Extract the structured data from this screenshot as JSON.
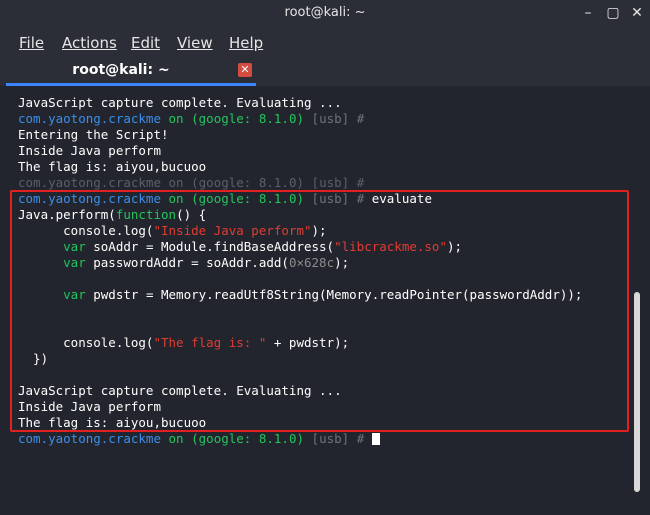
{
  "window": {
    "title": "root@kali: ~",
    "min_glyph": "–",
    "max_glyph": "▢",
    "close_glyph": "✕"
  },
  "menu": {
    "items": [
      "File",
      "Actions",
      "Edit",
      "View",
      "Help"
    ]
  },
  "tab": {
    "label": "root@kali: ~",
    "close_glyph": "✕"
  },
  "prompt": {
    "package": "com.yaotong.crackme",
    "on": "on",
    "device": "(google: 8.1.0)",
    "usb": "[usb] #"
  },
  "terminal": {
    "l1": "JavaScript capture complete. Evaluating ...",
    "l3": "Entering the Script!",
    "l4": "Inside Java perform",
    "l5": "The flag is: aiyou,bucuoo",
    "cmd": " evaluate",
    "c1a": "Java.perform(",
    "c1kw": "function",
    "c1b": "() {",
    "c2a": "      console.log(",
    "c2s": "\"Inside Java perform\"",
    "c2b": ");",
    "c3kw": "      var",
    "c3a": " soAddr = Module.findBaseAddress(",
    "c3s": "\"libcrackme.so\"",
    "c3b": ");",
    "c4kw": "      var",
    "c4a": " passwordAddr = soAddr.add(",
    "c4n": "0×628c",
    "c4b": ");",
    "c5kw": "      var",
    "c5a": " pwdstr = Memory.readUtf8String(Memory.readPointer(passwordAddr));",
    "c6a": "      console.log(",
    "c6s": "\"The flag is: \"",
    "c6b": " + pwdstr);",
    "c7": "  })",
    "o1": "JavaScript capture complete. Evaluating ...",
    "o2": "Inside Java perform",
    "o3": "The flag is: aiyou,bucuoo"
  },
  "colors": {
    "prompt_blue": "#3b8eea",
    "prompt_green": "#22c55e",
    "string_red": "#e03c31",
    "highlight_red": "#e0211f"
  }
}
